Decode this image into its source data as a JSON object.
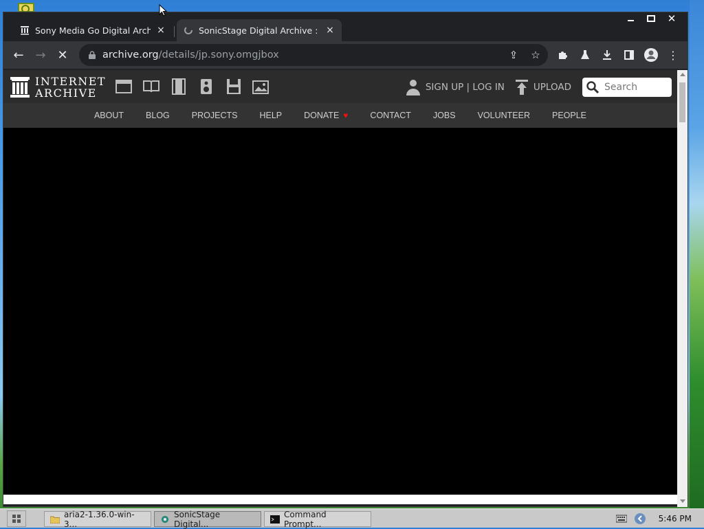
{
  "browser": {
    "tabs": [
      {
        "title": "Sony Media Go Digital Archive",
        "close": "×"
      },
      {
        "title": "SonicStage Digital Archive : S",
        "close": "×"
      }
    ],
    "url_host": "archive.org",
    "url_path": "/details/jp.sony.omgjbox"
  },
  "site": {
    "logo_line1": "INTERNET",
    "logo_line2": "ARCHIVE",
    "auth": "SIGN UP | LOG IN",
    "upload": "UPLOAD",
    "search_placeholder": "Search",
    "nav": [
      "ABOUT",
      "BLOG",
      "PROJECTS",
      "HELP",
      "DONATE",
      "CONTACT",
      "JOBS",
      "VOLUNTEER",
      "PEOPLE"
    ]
  },
  "taskbar": {
    "tasks": [
      {
        "label": "aria2-1.36.0-win-3..."
      },
      {
        "label": "SonicStage Digital..."
      },
      {
        "label": "Command Prompt..."
      }
    ],
    "clock": "5:46 PM"
  },
  "colors": {
    "chrome_dark": "#202124",
    "toolbar": "#35363a",
    "ia_header": "#2c2c2c",
    "ia_nav": "#333333",
    "donate_heart": "#ee1111"
  }
}
